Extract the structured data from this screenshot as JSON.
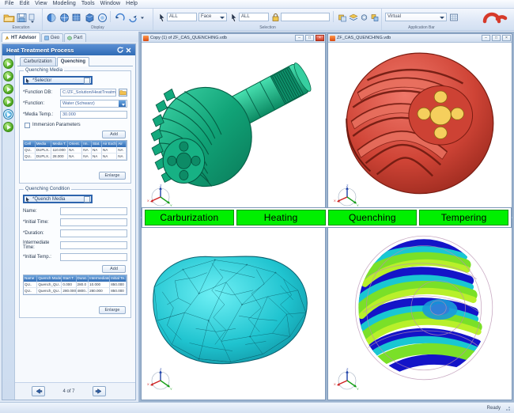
{
  "menu": {
    "items": [
      "File",
      "Edit",
      "View",
      "Modeling",
      "Tools",
      "Window",
      "Help"
    ]
  },
  "ribbon": {
    "groups": [
      {
        "label": "Execution",
        "icons": [
          "folder-open-icon",
          "save-icon",
          "save-dropdown-icon"
        ]
      },
      {
        "label": "Display",
        "icons": [
          "shaded-view-icon",
          "wireframe-view-icon",
          "mesh-view-icon",
          "solid-view-icon",
          "transparent-view-icon",
          "rotate-icon",
          "pan-icon",
          "zoom-dropdown-icon"
        ]
      },
      {
        "label": "Selection",
        "icons": [
          "pointer-icon",
          "pointer-node-icon",
          "lock-icon",
          "pick-filter-icon",
          "group-icon",
          "layer-icon",
          "gear-icon",
          "props-icon"
        ]
      },
      {
        "label": "Application Bar",
        "icons": [
          "app-grid-icon"
        ]
      }
    ],
    "selection": {
      "entity_value": "ALL",
      "type_value": "Face",
      "node_value": "ALL",
      "name_value": ""
    },
    "application": {
      "mode_value": "Virtual"
    }
  },
  "panel_tabs": [
    {
      "label": "HT Advisor",
      "icon": "wrench-icon",
      "active": true
    },
    {
      "label": "Geo",
      "icon": "geometry-icon",
      "active": false
    },
    {
      "label": "Part",
      "icon": "part-icon",
      "active": false
    }
  ],
  "left_panel": {
    "title": "Heat Treatment Process",
    "title_buttons": [
      "reset-icon",
      "close-icon"
    ],
    "step_buttons": [
      {
        "name": "step-carburization",
        "state": "done"
      },
      {
        "name": "step-heating",
        "state": "done"
      },
      {
        "name": "step-quenching",
        "state": "done"
      },
      {
        "name": "step-tempering",
        "state": "done"
      },
      {
        "name": "step-current",
        "state": "selected"
      },
      {
        "name": "step-next",
        "state": "done"
      }
    ],
    "sub_tabs": [
      {
        "label": "Carburization",
        "active": false
      },
      {
        "label": "Quenching",
        "active": true
      }
    ],
    "quenching_media": {
      "legend": "Quenching Media",
      "selector_label": "*Selector",
      "fields": [
        {
          "label": "*Function DB:",
          "value": "C:/ZF_Solution/HeatTreatment/LCFMM",
          "kind": "text-with-browse"
        },
        {
          "label": "*Function:",
          "value": "Water (Schwarz)",
          "kind": "combo"
        },
        {
          "label": "*Media Temp.:",
          "value": "30.000",
          "kind": "text"
        }
      ],
      "checkbox_label": "Immersion Parameters",
      "add_button": "Add",
      "enlarge_button": "Enlarge",
      "table": {
        "headers": [
          "Cell",
          "Media",
          "Media T.",
          "Orient.",
          "Im..",
          "Stat.",
          "Air Exch.",
          "Air"
        ],
        "rows": [
          [
            "QU..",
            "DUPLX..",
            "110.000",
            "NA",
            "NA",
            "NA",
            "NA",
            "NA"
          ],
          [
            "QU..",
            "DUPLX..",
            "28.000",
            "NA",
            "NA",
            "NA",
            "NA",
            "NA"
          ]
        ]
      }
    },
    "quenching_condition": {
      "legend": "Quenching Condition",
      "selector_label": "*Quench Media",
      "fields": [
        {
          "label": "Name:",
          "value": ""
        },
        {
          "label": "*Initial Time:",
          "value": ""
        },
        {
          "label": "*Duration:",
          "value": ""
        },
        {
          "label": "Intermediate Time:",
          "value": ""
        },
        {
          "label": "*Initial Temp.:",
          "value": ""
        }
      ],
      "add_button": "Add",
      "enlarge_button": "Enlarge",
      "table": {
        "headers": [
          "Name",
          "Quench Mode",
          "Start T.",
          "Durat.",
          "Intermediate T.",
          "Initial Te."
        ],
        "rows": [
          [
            "QU..",
            "Quench_QU..",
            "0.000",
            "280.0",
            "10.000",
            "850.000"
          ],
          [
            "QU..",
            "Quench_QU..",
            "280.000",
            "4800..",
            "280.000",
            "850.000"
          ]
        ]
      }
    },
    "nav": {
      "prev_icon": "arrow-left-icon",
      "next_icon": "arrow-right-icon",
      "page_text": "4 of 7"
    }
  },
  "viewports": [
    {
      "name": "viewport-top-left",
      "title": "Copy (1) of ZF_CAS_QUENCHING.vdb",
      "window_buttons": [
        "minimize",
        "maximize",
        "close"
      ],
      "model": "bevel-pinion-gear-green",
      "triad": true
    },
    {
      "name": "viewport-top-right",
      "title": "ZF_CAS_QUENCHING.vdb",
      "window_buttons": [
        "minimize",
        "maximize",
        "close"
      ],
      "model": "bevel-gear-red",
      "triad": true
    },
    {
      "name": "viewport-bottom-left",
      "title": "",
      "window_buttons": [],
      "model": "mesh-tetrahedral-cyan",
      "triad": true
    },
    {
      "name": "viewport-bottom-right",
      "title": "",
      "window_buttons": [],
      "model": "contour-results-gear",
      "triad": true
    }
  ],
  "stage_bar": {
    "stages": [
      "Carburization",
      "Heating",
      "Quenching",
      "Tempering"
    ],
    "color": "#00f000"
  },
  "status_bar": {
    "text": "Ready"
  },
  "colors": {
    "accent": "#2f6bb5",
    "stage_green": "#00f000",
    "model_green": "#12a37c",
    "model_red": "#c0392b",
    "mesh_cyan": "#25c6d6"
  }
}
